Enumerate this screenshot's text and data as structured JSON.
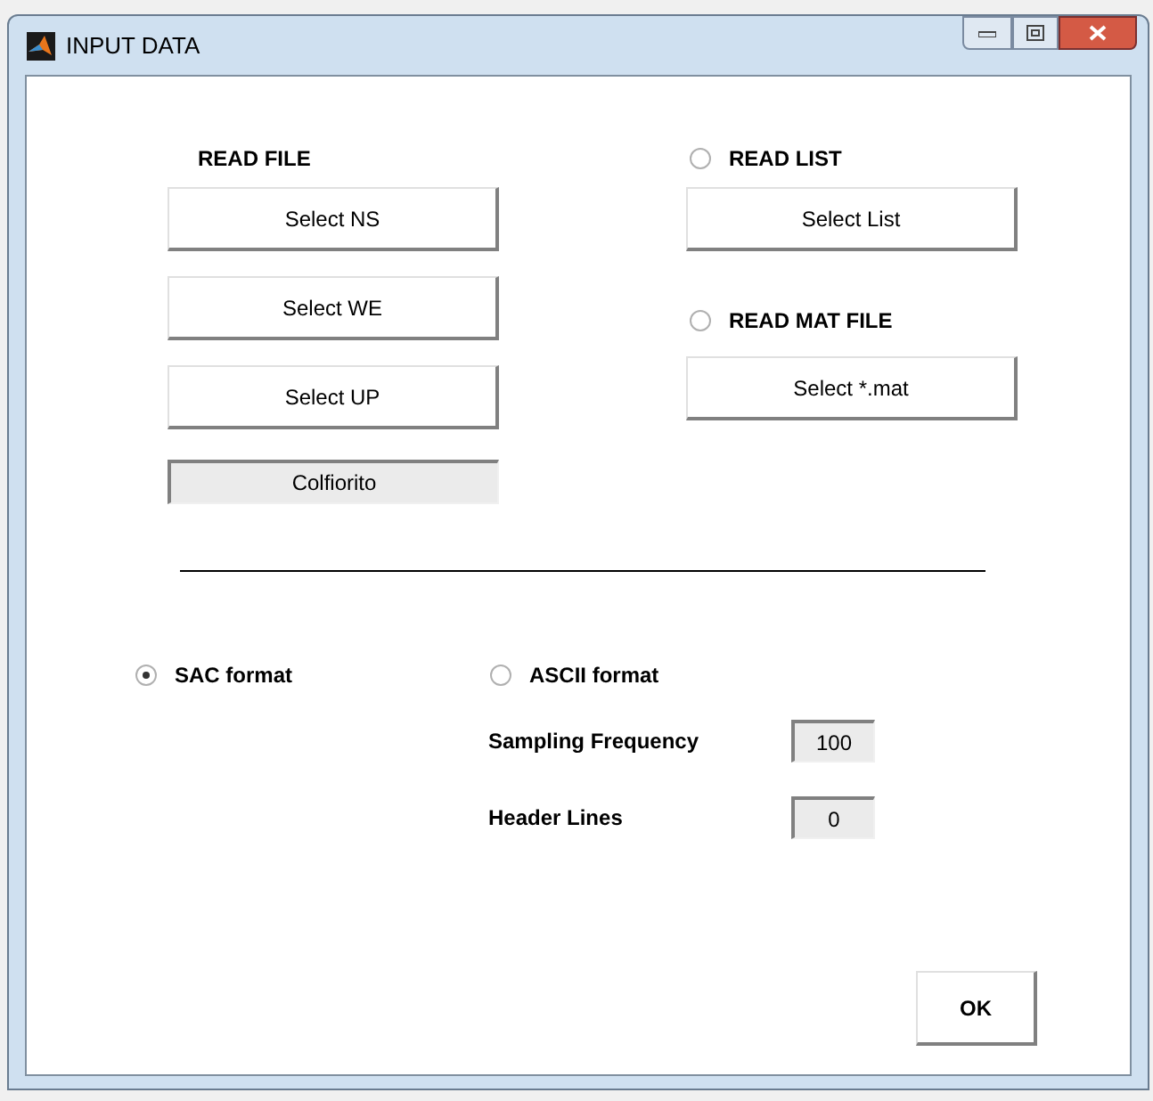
{
  "window": {
    "title": "INPUT DATA"
  },
  "read_file": {
    "label": "READ FILE",
    "buttons": [
      "Select NS",
      "Select WE",
      "Select UP"
    ],
    "station": "Colfiorito"
  },
  "read_list": {
    "label": "READ LIST",
    "selected": false,
    "button": "Select List"
  },
  "read_mat": {
    "label": "READ MAT FILE",
    "selected": false,
    "button": "Select *.mat"
  },
  "formats": [
    {
      "label": "SAC format",
      "selected": true
    },
    {
      "label": "ASCII format",
      "selected": false
    }
  ],
  "params": [
    {
      "label": "Sampling Frequency",
      "value": "100"
    },
    {
      "label": "Header Lines",
      "value": "0"
    }
  ],
  "ok_button": "OK"
}
